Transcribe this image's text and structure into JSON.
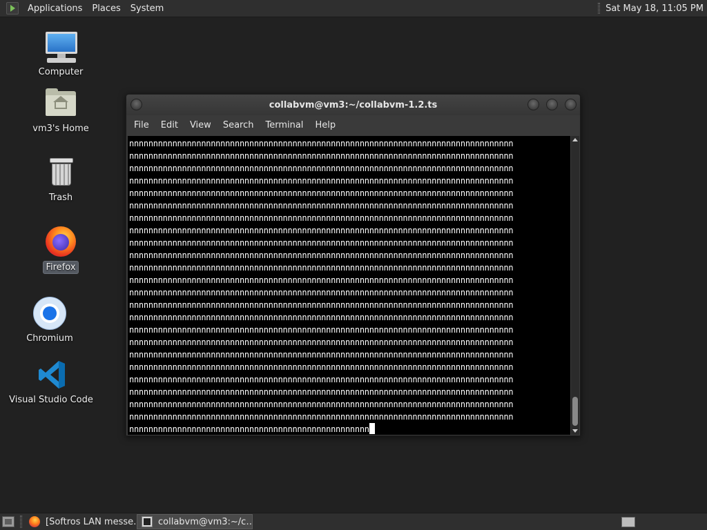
{
  "top_panel": {
    "menus": [
      "Applications",
      "Places",
      "System"
    ],
    "clock": "Sat May 18, 11:05 PM"
  },
  "desktop_icons": [
    {
      "label": "Computer",
      "icon": "computer-icon"
    },
    {
      "label": "vm3's Home",
      "icon": "home-folder-icon"
    },
    {
      "label": "Trash",
      "icon": "trash-icon"
    },
    {
      "label": "Firefox",
      "icon": "firefox-icon",
      "selected": true
    },
    {
      "label": "Chromium",
      "icon": "chromium-icon"
    },
    {
      "label": "Visual Studio Code",
      "icon": "vscode-icon"
    }
  ],
  "terminal": {
    "title": "collabvm@vm3:~/collabvm-1.2.ts",
    "menu": [
      "File",
      "Edit",
      "View",
      "Search",
      "Terminal",
      "Help"
    ],
    "full_line": "nnnnnnnnnnnnnnnnnnnnnnnnnnnnnnnnnnnnnnnnnnnnnnnnnnnnnnnnnnnnnnnnnnnnnnnnnnnnnnnn",
    "last_line": "nnnnnnnnnnnnnnnnnnnnnnnnnnnnnnnnnnnnnnnnnnnnnnnnnn",
    "full_line_count": 23,
    "colors": {
      "background": "#000000",
      "foreground": "#ffffff"
    }
  },
  "taskbar": {
    "tasks": [
      {
        "label": "[Softros LAN messe…",
        "icon": "firefox-icon",
        "active": false
      },
      {
        "label": "collabvm@vm3:~/c…",
        "icon": "terminal-icon",
        "active": true
      }
    ]
  }
}
